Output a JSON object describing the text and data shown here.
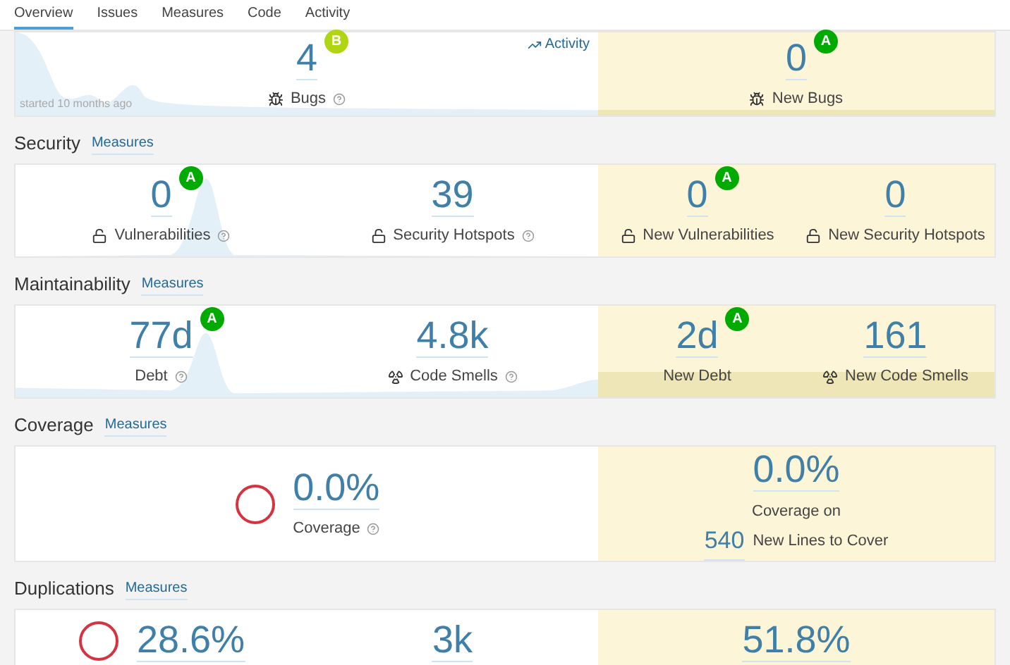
{
  "tabs": [
    {
      "label": "Overview",
      "selected": true
    },
    {
      "label": "Issues",
      "selected": false
    },
    {
      "label": "Measures",
      "selected": false
    },
    {
      "label": "Code",
      "selected": false
    },
    {
      "label": "Activity",
      "selected": false
    }
  ],
  "sections": [
    {
      "activity_link": "Activity",
      "started": "started 10 months ago",
      "overall": [
        {
          "kind": "metric",
          "value": "4",
          "rating": {
            "letter": "B",
            "color": "#b0d513"
          },
          "label": "Bugs"
        }
      ],
      "new": [
        {
          "kind": "metric",
          "value": "0",
          "rating": {
            "letter": "A",
            "color": "#00aa00"
          },
          "label": "New Bugs"
        }
      ]
    },
    {
      "title": "Security",
      "link": "Measures",
      "overall": [
        {
          "kind": "metric",
          "value": "0",
          "rating": {
            "letter": "A",
            "color": "#00aa00"
          },
          "label": "Vulnerabilities"
        },
        {
          "kind": "metric",
          "value": "39",
          "label": "Security Hotspots"
        }
      ],
      "new": [
        {
          "kind": "metric",
          "value": "0",
          "rating": {
            "letter": "A",
            "color": "#00aa00"
          },
          "label": "New Vulnerabilities"
        },
        {
          "kind": "metric",
          "value": "0",
          "label": "New Security Hotspots"
        }
      ]
    },
    {
      "title": "Maintainability",
      "link": "Measures",
      "overall": [
        {
          "kind": "metric",
          "value": "77d",
          "rating": {
            "letter": "A",
            "color": "#00aa00"
          },
          "label": "Debt"
        },
        {
          "kind": "metric",
          "value": "4.8k",
          "label": "Code Smells"
        }
      ],
      "new": [
        {
          "kind": "metric",
          "value": "2d",
          "rating": {
            "letter": "A",
            "color": "#00aa00"
          },
          "label": "New Debt"
        },
        {
          "kind": "metric",
          "value": "161",
          "label": "New Code Smells"
        }
      ]
    },
    {
      "title": "Coverage",
      "link": "Measures",
      "overall": [
        {
          "kind": "gauge",
          "value": "0.0%",
          "label": "Coverage"
        }
      ],
      "new": [
        {
          "kind": "new_coverage",
          "value": "0.0%",
          "label": "Coverage on",
          "sub_value": "540",
          "sub_label": "New Lines to Cover"
        }
      ]
    },
    {
      "title": "Duplications",
      "link": "Measures",
      "overall": [
        {
          "kind": "gauge",
          "value": "28.6%"
        },
        {
          "kind": "metric",
          "value": "3k"
        }
      ],
      "new": [
        {
          "kind": "metric",
          "value": "51.8%"
        }
      ]
    }
  ]
}
